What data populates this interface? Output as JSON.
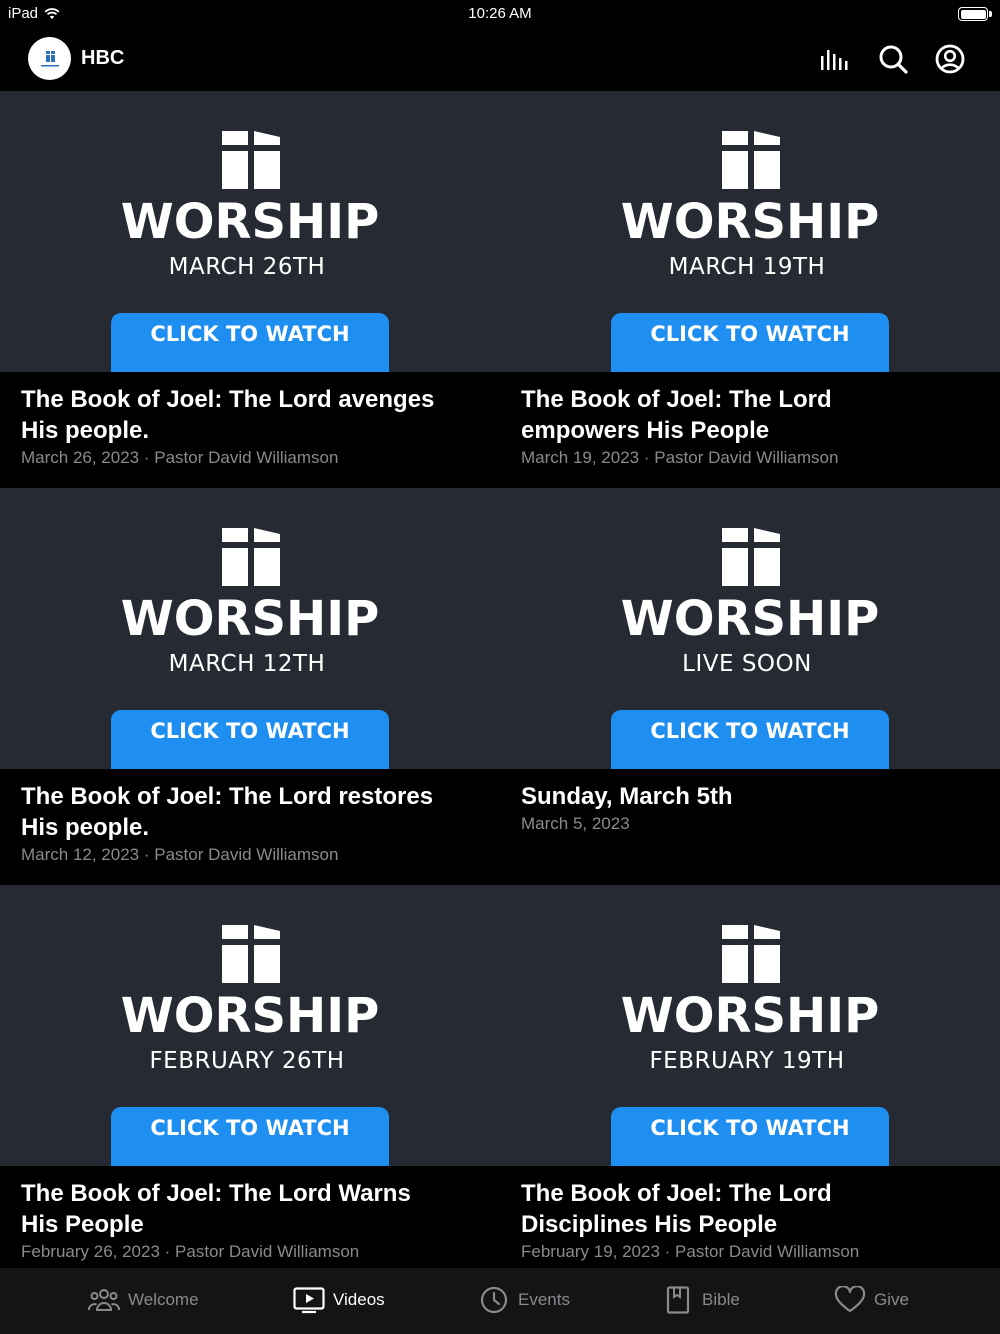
{
  "status_bar": {
    "device": "iPad",
    "time": "10:26 AM"
  },
  "header": {
    "title": "HBC"
  },
  "cards": [
    {
      "worship": "WORSHIP",
      "subtitle": "MARCH 26TH",
      "cta": "CLICK TO WATCH",
      "title_line1": "The Book of Joel: The Lord avenges",
      "title_line2": "His people.",
      "meta": "March 26, 2023 · Pastor David Williamson"
    },
    {
      "worship": "WORSHIP",
      "subtitle": "MARCH 19TH",
      "cta": "CLICK TO WATCH",
      "title_line1": "The Book of Joel: The Lord",
      "title_line2": "empowers His People",
      "meta": "March 19, 2023 · Pastor David Williamson"
    },
    {
      "worship": "WORSHIP",
      "subtitle": "MARCH 12TH",
      "cta": "CLICK TO WATCH",
      "title_line1": "The Book of Joel: The Lord restores",
      "title_line2": "His people.",
      "meta": "March 12, 2023 · Pastor David Williamson"
    },
    {
      "worship": "WORSHIP",
      "subtitle": "LIVE SOON",
      "cta": "CLICK TO WATCH",
      "title_line1": "Sunday, March 5th",
      "title_line2": "",
      "meta": "March 5, 2023"
    },
    {
      "worship": "WORSHIP",
      "subtitle": "FEBRUARY 26TH",
      "cta": "CLICK TO WATCH",
      "title_line1": "The Book of Joel: The Lord Warns",
      "title_line2": "His People",
      "meta": "February 26, 2023 · Pastor David Williamson"
    },
    {
      "worship": "WORSHIP",
      "subtitle": "FEBRUARY 19TH",
      "cta": "CLICK TO WATCH",
      "title_line1": "The Book of Joel: The Lord",
      "title_line2": "Disciplines His People",
      "meta": "February 19, 2023 · Pastor David Williamson"
    }
  ],
  "tabs": [
    {
      "label": "Welcome",
      "icon": "people-icon",
      "active": false
    },
    {
      "label": "Videos",
      "icon": "video-icon",
      "active": true
    },
    {
      "label": "Events",
      "icon": "clock-icon",
      "active": false
    },
    {
      "label": "Bible",
      "icon": "book-icon",
      "active": false
    },
    {
      "label": "Give",
      "icon": "heart-icon",
      "active": false
    }
  ],
  "colors": {
    "accent": "#1f8ef1",
    "card_bg": "#252a33",
    "inactive": "#8a8a8e"
  }
}
